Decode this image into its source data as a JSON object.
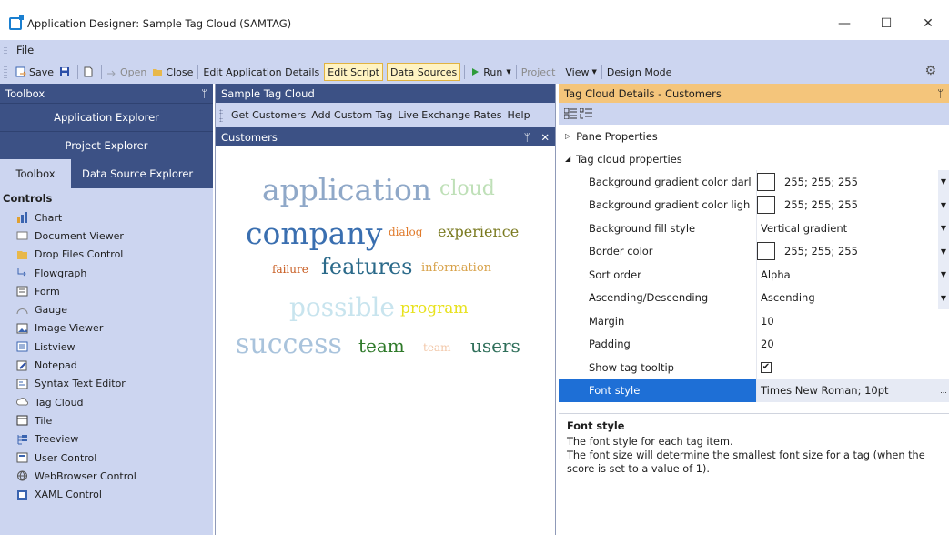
{
  "window": {
    "title": "Application Designer: Sample Tag Cloud  (SAMTAG)",
    "minimize": "—",
    "maximize": "☐",
    "close": "✕"
  },
  "menu": {
    "file": "File"
  },
  "toolbar": {
    "save": "Save",
    "open": "Open",
    "close": "Close",
    "edit_app_details": "Edit Application Details",
    "edit_script": "Edit Script",
    "data_sources": "Data Sources",
    "run": "Run",
    "project": "Project",
    "view": "View",
    "design_mode": "Design Mode"
  },
  "toolbox": {
    "title": "Toolbox",
    "pin": "ᛘ",
    "app_explorer": "Application Explorer",
    "project_explorer": "Project Explorer",
    "tab_toolbox": "Toolbox",
    "tab_data_source": "Data Source Explorer",
    "controls_heading": "Controls",
    "items": [
      {
        "label": "Chart",
        "icon": "chart-icon"
      },
      {
        "label": "Document Viewer",
        "icon": "document-viewer-icon"
      },
      {
        "label": "Drop Files Control",
        "icon": "folder-icon"
      },
      {
        "label": "Flowgraph",
        "icon": "flowgraph-icon"
      },
      {
        "label": "Form",
        "icon": "form-icon"
      },
      {
        "label": "Gauge",
        "icon": "gauge-icon"
      },
      {
        "label": "Image Viewer",
        "icon": "image-icon"
      },
      {
        "label": "Listview",
        "icon": "listview-icon"
      },
      {
        "label": "Notepad",
        "icon": "notepad-icon"
      },
      {
        "label": "Syntax Text Editor",
        "icon": "syntax-editor-icon"
      },
      {
        "label": "Tag Cloud",
        "icon": "tag-cloud-icon"
      },
      {
        "label": "Tile",
        "icon": "tile-icon"
      },
      {
        "label": "Treeview",
        "icon": "treeview-icon"
      },
      {
        "label": "User Control",
        "icon": "user-control-icon"
      },
      {
        "label": "WebBrowser Control",
        "icon": "globe-icon"
      },
      {
        "label": "XAML Control",
        "icon": "xaml-icon"
      }
    ]
  },
  "center": {
    "title": "Sample Tag Cloud",
    "actions": [
      "Get Customers",
      "Add Custom Tag",
      "Live Exchange Rates",
      "Help"
    ],
    "pane_title": "Customers",
    "pane_pin": "ᛘ",
    "pane_close": "✕",
    "tags": [
      {
        "text": "application",
        "color": "#8fa8c8"
      },
      {
        "text": "cloud",
        "color": "#bfe0b8"
      },
      {
        "text": "company",
        "color": "#3a6fb0"
      },
      {
        "text": "dialog",
        "color": "#e07a2a"
      },
      {
        "text": "experience",
        "color": "#7a7a20"
      },
      {
        "text": "failure",
        "color": "#c75a1e"
      },
      {
        "text": "features",
        "color": "#2b6a8a"
      },
      {
        "text": "information",
        "color": "#d8a24a"
      },
      {
        "text": "possible",
        "color": "#c8e4ee"
      },
      {
        "text": "program",
        "color": "#e8e21e"
      },
      {
        "text": "success",
        "color": "#a9c3dc"
      },
      {
        "text": "team",
        "color": "#2f7a2a"
      },
      {
        "text": "team",
        "color": "#f2c7a8"
      },
      {
        "text": "users",
        "color": "#2f6f5a"
      }
    ]
  },
  "details": {
    "title": "Tag Cloud Details - Customers",
    "pin": "ᛘ",
    "pane_properties": "Pane Properties",
    "tag_cloud_properties": "Tag cloud properties",
    "props": [
      {
        "name": "Background gradient color darl",
        "value": "255; 255; 255",
        "swatch": true,
        "dropdown": true
      },
      {
        "name": "Background gradient color ligh",
        "value": "255; 255; 255",
        "swatch": true,
        "dropdown": true
      },
      {
        "name": "Background fill style",
        "value": "Vertical gradient",
        "swatch": false,
        "dropdown": true
      },
      {
        "name": "Border color",
        "value": "255; 255; 255",
        "swatch": true,
        "dropdown": true
      },
      {
        "name": "Sort order",
        "value": "Alpha",
        "swatch": false,
        "dropdown": true
      },
      {
        "name": "Ascending/Descending",
        "value": "Ascending",
        "swatch": false,
        "dropdown": true
      },
      {
        "name": "Margin",
        "value": "10",
        "swatch": false,
        "dropdown": false
      },
      {
        "name": "Padding",
        "value": "20",
        "swatch": false,
        "dropdown": false
      }
    ],
    "tooltip_name": "Show tag tooltip",
    "tooltip_checked": "✔",
    "font_name": "Font style",
    "font_value": "Times New Roman; 10pt",
    "font_ellipsis": "...",
    "desc_title": "Font style",
    "desc_line1": "The font style for each tag item.",
    "desc_line2": "The font size will determine the smallest font size for a tag (when the score is set to a value of 1)."
  },
  "colors": {
    "accent_dark": "#3c5185",
    "chrome": "#ccd5f0",
    "details_header": "#f4c57b",
    "selection": "#1e6fd6",
    "highlight_button": "#fff3c2"
  }
}
